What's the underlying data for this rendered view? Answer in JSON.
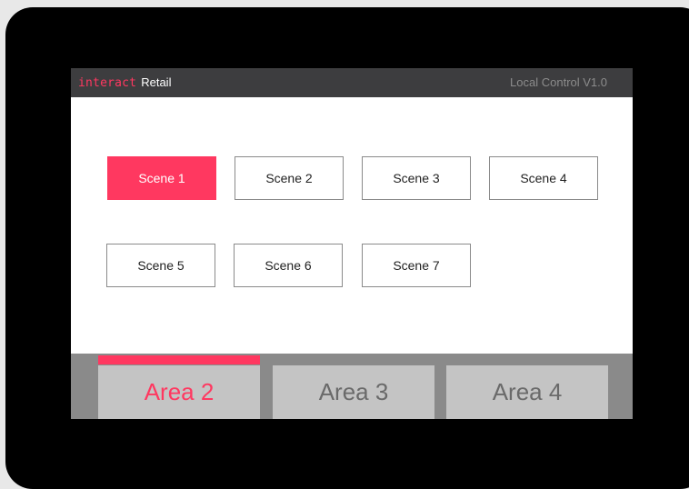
{
  "colors": {
    "accent": "#ff3860",
    "muted_text": "#6a6a6a",
    "header_right_text": "#8c8c8c",
    "header_bg": "#3d3d3f"
  },
  "header": {
    "logo_text": "interact",
    "product": "Retail",
    "version": "Local Control V1.0"
  },
  "scenes": [
    {
      "label": "Scene 1",
      "active": true
    },
    {
      "label": "Scene 2",
      "active": false
    },
    {
      "label": "Scene 3",
      "active": false
    },
    {
      "label": "Scene 4",
      "active": false
    },
    {
      "label": "Scene 5",
      "active": false
    },
    {
      "label": "Scene 6",
      "active": false
    },
    {
      "label": "Scene 7",
      "active": false
    }
  ],
  "areas": [
    {
      "label": "Area 2",
      "active": true
    },
    {
      "label": "Area 3",
      "active": false
    },
    {
      "label": "Area 4",
      "active": false
    }
  ]
}
